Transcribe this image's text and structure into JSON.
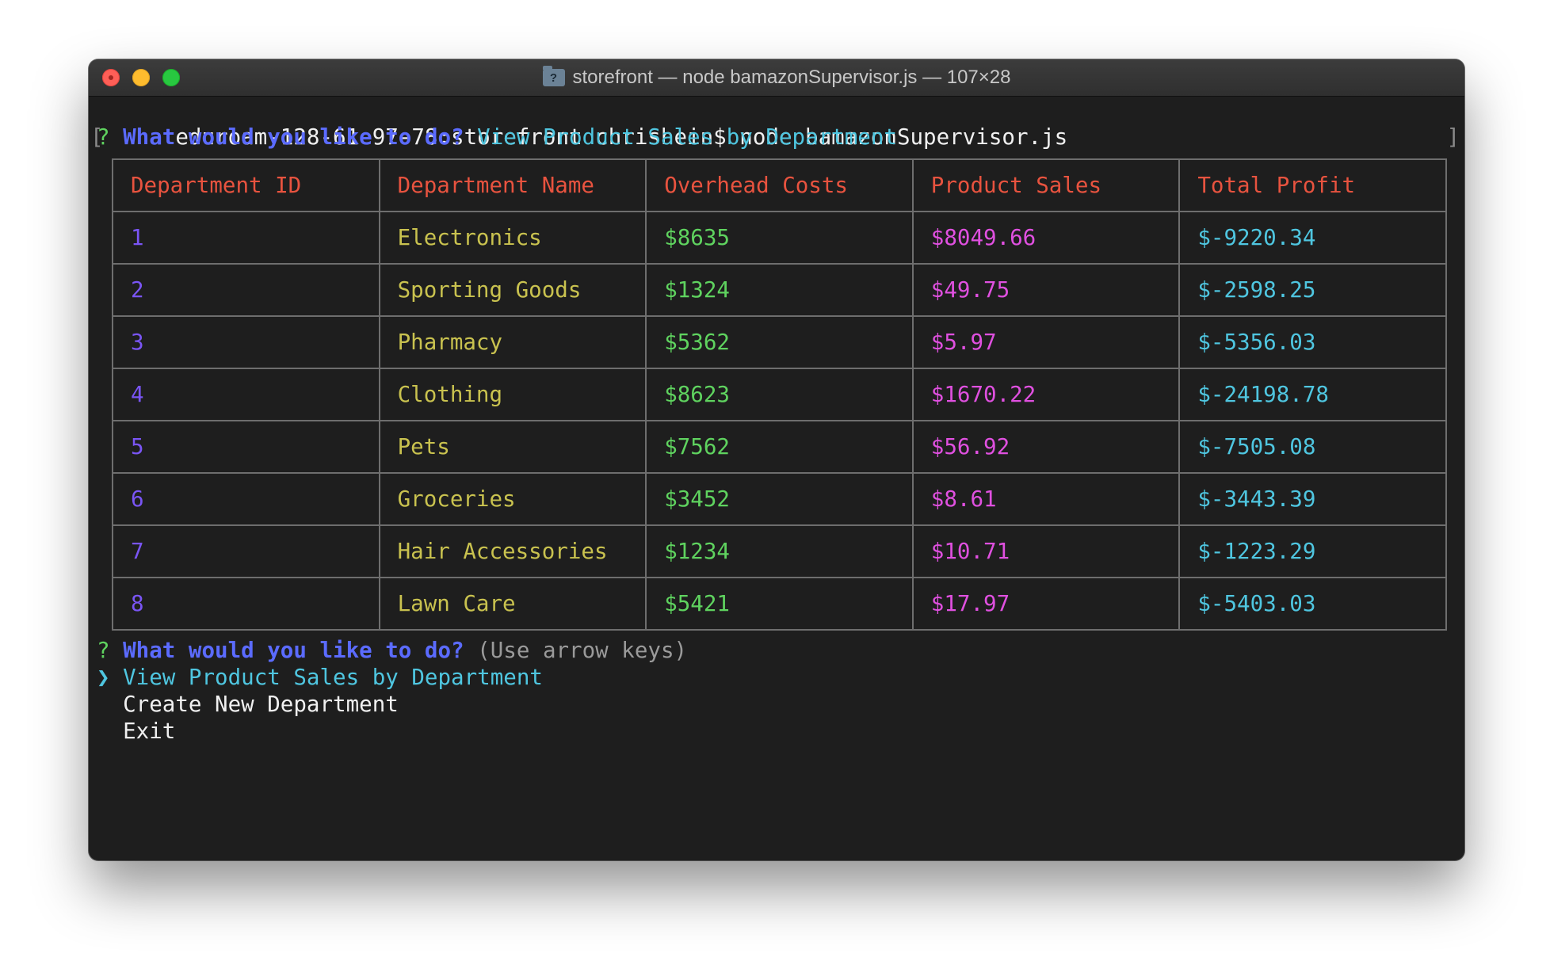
{
  "window": {
    "title": "storefront — node bamazonSupervisor.js — 107×28",
    "folder_glyph": "?"
  },
  "terminal": {
    "command_line": "eduroam-128-61-97-78:storefront chrishein$ node bamazonSupervisor.js",
    "bracket_left": "[",
    "bracket_right": "]",
    "prompt_mark": "?",
    "prompt_question": "What would you like to do?",
    "prompt_answer": "View Product Sales by Department",
    "prompt2_hint": "(Use arrow keys)",
    "menu_pointer": "❯",
    "menu_items": [
      "View Product Sales by Department",
      "Create New Department",
      "Exit"
    ]
  },
  "table": {
    "headers": [
      "Department ID",
      "Department Name",
      "Overhead Costs",
      "Product Sales",
      "Total Profit"
    ],
    "rows": [
      [
        "1",
        "Electronics",
        "$8635",
        "$8049.66",
        "$-9220.34"
      ],
      [
        "2",
        "Sporting Goods",
        "$1324",
        "$49.75",
        "$-2598.25"
      ],
      [
        "3",
        "Pharmacy",
        "$5362",
        "$5.97",
        "$-5356.03"
      ],
      [
        "4",
        "Clothing",
        "$8623",
        "$1670.22",
        "$-24198.78"
      ],
      [
        "5",
        "Pets",
        "$7562",
        "$56.92",
        "$-7505.08"
      ],
      [
        "6",
        "Groceries",
        "$3452",
        "$8.61",
        "$-3443.39"
      ],
      [
        "7",
        "Hair Accessories",
        "$1234",
        "$10.71",
        "$-1223.29"
      ],
      [
        "8",
        "Lawn Care",
        "$5421",
        "$17.97",
        "$-5403.03"
      ]
    ]
  }
}
